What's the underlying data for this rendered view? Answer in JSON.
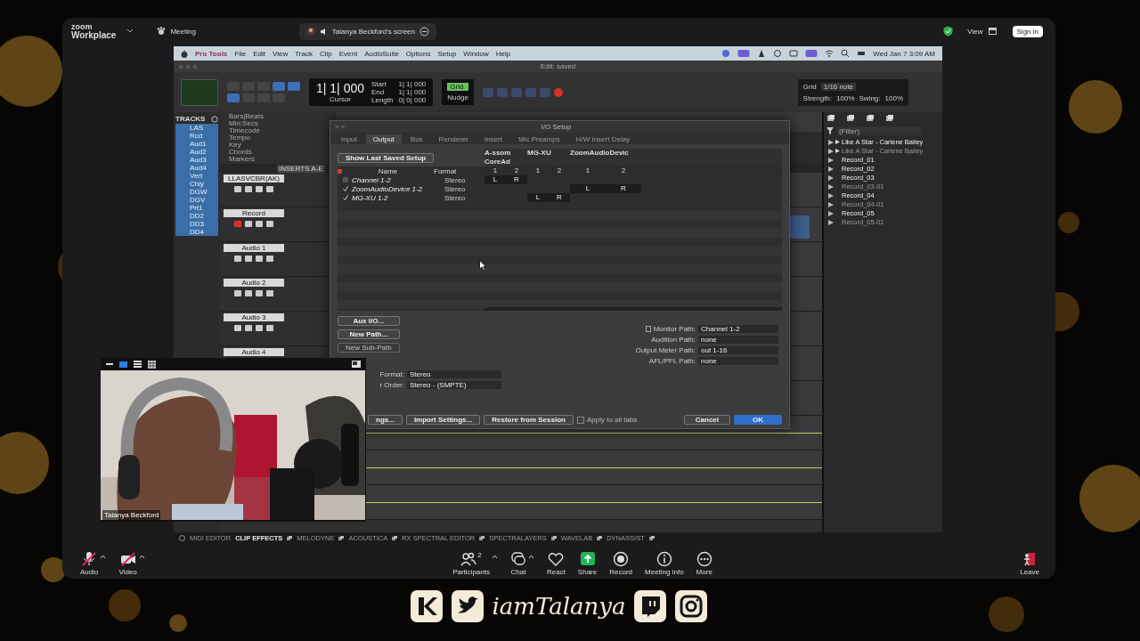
{
  "zoom_bar": {
    "logo_top": "zoom",
    "logo_bottom": "Workplace",
    "meeting": "Meeting",
    "share_title": "Talanya Beckford's screen",
    "view": "View",
    "sign_in": "Sign in"
  },
  "menu_bar": {
    "items": [
      "Pro Tools",
      "File",
      "Edit",
      "View",
      "Track",
      "Clip",
      "Event",
      "AudioSuite",
      "Options",
      "Setup",
      "Window",
      "Help"
    ],
    "clock": "Wed Jan 7  3:09 AM"
  },
  "edit_window": {
    "title": "Edit: saved"
  },
  "toolbar": {
    "counter": "1| 1| 000",
    "start_label": "Start",
    "end_label": "End",
    "length_label": "Length",
    "start": "1| 1| 000",
    "end": "1| 1| 000",
    "length": "0| 0| 000",
    "cursor_label": "Cursor",
    "grid_mode_label": "Grid",
    "grid_label": "Grid",
    "grid_value": "1/16 note",
    "nudge_label": "Nudge",
    "strength_label": "Strength:",
    "strength": "100%",
    "swing_label": "Swing:",
    "swing": "100%"
  },
  "tracks_list": {
    "title": "TRACKS",
    "items": [
      {
        "name": "LAS",
        "selected": true
      },
      {
        "name": "Rcd",
        "selected": true
      },
      {
        "name": "Aud1",
        "selected": true
      },
      {
        "name": "Aud2",
        "selected": true
      },
      {
        "name": "Aud3",
        "selected": true
      },
      {
        "name": "Aud4",
        "selected": true
      },
      {
        "name": "Vert",
        "selected": true
      },
      {
        "name": "Chly",
        "selected": true
      },
      {
        "name": "DGW",
        "selected": true
      },
      {
        "name": "DGV",
        "selected": true
      },
      {
        "name": "Prt1",
        "selected": true
      },
      {
        "name": "DD2",
        "selected": true
      },
      {
        "name": "DD3",
        "selected": true
      },
      {
        "name": "DD4",
        "selected": true
      }
    ]
  },
  "rulers": [
    "Bars|Beats",
    "Min:Secs",
    "Timecode",
    "Tempo",
    "Key",
    "Chords",
    "Markers"
  ],
  "inserts_header": "INSERTS A-E",
  "tracks": [
    {
      "name": "LLASVCBR(AK)",
      "record_armed": false,
      "lane_line": false
    },
    {
      "name": "Record",
      "record_armed": true,
      "lane_line": false
    },
    {
      "name": "Audio 1",
      "record_armed": false,
      "lane_line": false
    },
    {
      "name": "Audio 2",
      "record_armed": false,
      "lane_line": false
    },
    {
      "name": "Audio 3",
      "record_armed": false,
      "lane_line": false
    },
    {
      "name": "Audio 4",
      "lane_line": false
    },
    {
      "lane_line": false
    },
    {
      "lane_line": true
    },
    {
      "lane_line": true
    },
    {
      "lane_line": true
    }
  ],
  "dialog": {
    "title": "I/O Setup",
    "tabs": [
      {
        "label": "Input",
        "selected": false
      },
      {
        "label": "Output",
        "selected": true
      },
      {
        "label": "Bus",
        "selected": false
      },
      {
        "label": "Renderer",
        "selected": false
      },
      {
        "label": "Insert",
        "selected": false
      },
      {
        "label": "Mic Preamps",
        "selected": false
      },
      {
        "label": "H/W Insert Delay",
        "selected": false
      }
    ],
    "show_last": "Show Last Saved Setup",
    "name_header": "Name",
    "format_header": "Format",
    "devices": [
      {
        "name": "A-ssom CoreAd",
        "channels": [
          "1",
          "2"
        ]
      },
      {
        "name": "MG-XU",
        "channels": [
          "1",
          "2"
        ]
      },
      {
        "name": "ZoomAudioDevic",
        "channels": [
          "1",
          "2"
        ]
      }
    ],
    "rows": [
      {
        "name": "Channel 1-2",
        "format": "Stereo",
        "checked": false,
        "assigned": [
          true,
          false,
          false
        ],
        "labels": [
          "L",
          "R"
        ]
      },
      {
        "name": "ZoomAudioDevice 1-2",
        "format": "Stereo",
        "checked": true,
        "assigned": [
          false,
          false,
          true
        ],
        "labels": [
          "L",
          "R"
        ]
      },
      {
        "name": "MG-XU 1-2",
        "format": "Stereo",
        "checked": true,
        "assigned": [
          false,
          true,
          false
        ],
        "labels": [
          "L",
          "R"
        ]
      }
    ],
    "left_buttons": [
      {
        "label": "Aux I/O...",
        "disabled": false
      },
      {
        "label": "New Path...",
        "disabled": false
      },
      {
        "label": "New Sub-Path",
        "disabled": true
      }
    ],
    "paths": [
      {
        "label": "Monitor Path:",
        "value": "Channel 1-2"
      },
      {
        "label": "Audition Path:",
        "value": "none"
      },
      {
        "label": "Output Meter Path:",
        "value": "out 1-16"
      },
      {
        "label": "AFL/PFL Path:",
        "value": "none"
      }
    ],
    "format_fields": [
      {
        "label": "Format:",
        "value": "Stereo"
      },
      {
        "label": "r Order:",
        "value": "Stereo - (SMPTE)"
      }
    ],
    "export": "ngs...",
    "import": "Import Settings...",
    "restore": "Restore from Session",
    "apply_all": {
      "label": "Apply to all tabs",
      "checked": false
    },
    "cancel": "Cancel",
    "ok": "OK"
  },
  "clips": {
    "filter_placeholder": "(Filter)",
    "items": [
      {
        "name": "Like A Star - Carlene Bailey",
        "kind": "group",
        "dimmed": false
      },
      {
        "name": "Like A Star - Carlene Bailey",
        "kind": "group",
        "dimmed": true
      },
      {
        "name": "Record_01",
        "kind": "clip",
        "dimmed": false
      },
      {
        "name": "Record_02",
        "kind": "clip",
        "dimmed": false
      },
      {
        "name": "Record_03",
        "kind": "clip",
        "dimmed": false
      },
      {
        "name": "Record_03-01",
        "kind": "clip",
        "dimmed": true
      },
      {
        "name": "Record_04",
        "kind": "clip",
        "dimmed": false
      },
      {
        "name": "Record_04-01",
        "kind": "clip",
        "dimmed": true
      },
      {
        "name": "Record_05",
        "kind": "clip",
        "dimmed": false
      },
      {
        "name": "Record_05-01",
        "kind": "clip",
        "dimmed": true
      }
    ]
  },
  "plugin_bar": [
    "MIDI EDITOR",
    "CLIP EFFECTS",
    "MELODYNE",
    "ACOUSTICA",
    "RX SPECTRAL EDITOR",
    "SPECTRALAYERS",
    "WAVELAB",
    "DYNASSIST"
  ],
  "zoom_toolbar": {
    "left": [
      {
        "label": "Audio",
        "kind": "audio",
        "muted": true
      },
      {
        "label": "Video",
        "kind": "video",
        "muted": true
      }
    ],
    "center": [
      {
        "label": "Participants",
        "kind": "participants",
        "count": "2"
      },
      {
        "label": "Chat",
        "kind": "chat"
      },
      {
        "label": "React",
        "kind": "react"
      },
      {
        "label": "Share",
        "kind": "share"
      },
      {
        "label": "Record",
        "kind": "record"
      },
      {
        "label": "Meeting info",
        "kind": "info"
      },
      {
        "label": "More",
        "kind": "more"
      }
    ],
    "leave": "Leave"
  },
  "webcam": {
    "name": "Talanya Beckford"
  },
  "branding": {
    "handle": "iamTalanya"
  }
}
